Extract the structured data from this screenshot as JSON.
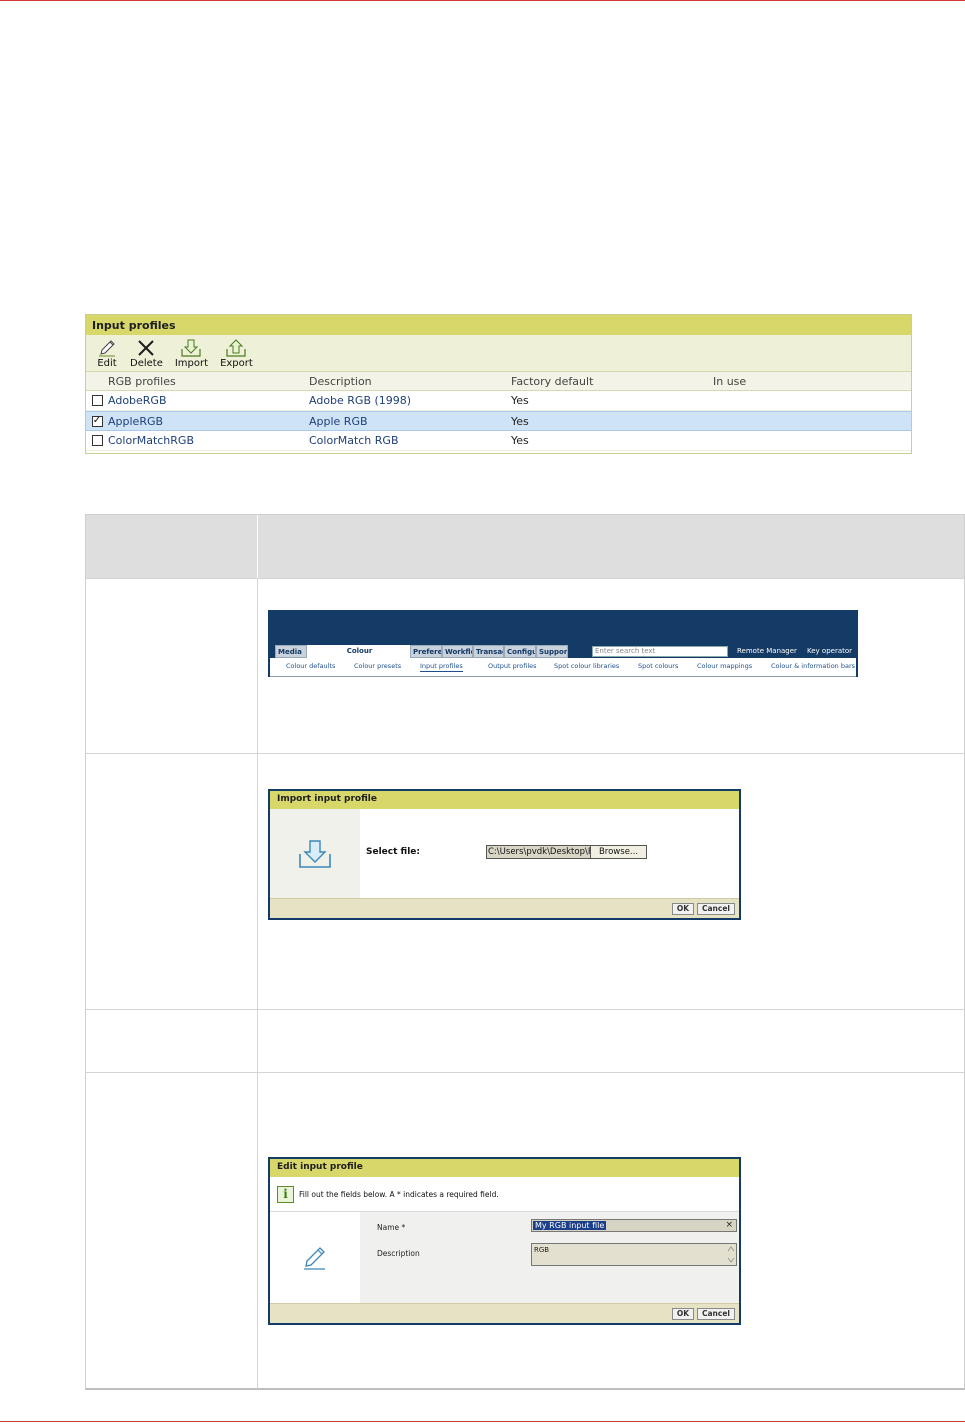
{
  "input_profiles": {
    "title": "Input profiles",
    "toolbar": {
      "edit": "Edit",
      "delete": "Delete",
      "import": "Import",
      "export": "Export"
    },
    "columns": {
      "name": "RGB profiles",
      "description": "Description",
      "factory_default": "Factory default",
      "in_use": "In use"
    },
    "rows": [
      {
        "checked": false,
        "name": "AdobeRGB",
        "description": "Adobe RGB (1998)",
        "factory_default": "Yes",
        "in_use": ""
      },
      {
        "checked": true,
        "name": "AppleRGB",
        "description": "Apple RGB",
        "factory_default": "Yes",
        "in_use": ""
      },
      {
        "checked": false,
        "name": "ColorMatchRGB",
        "description": "ColorMatch RGB",
        "factory_default": "Yes",
        "in_use": ""
      }
    ],
    "check_mark": "✓"
  },
  "navigation": {
    "tabs": {
      "media": "Media",
      "colour": "Colour",
      "preferences": "Preferen",
      "workflow": "Workflo",
      "transactions": "Transac",
      "configuration": "Configu",
      "support": "Support"
    },
    "search_placeholder": "Enter search text",
    "remote_manager": "Remote Manager",
    "key_operator": "Key operator",
    "subtabs": {
      "colour_defaults": "Colour defaults",
      "colour_presets": "Colour presets",
      "input_profiles": "Input profiles",
      "output_profiles": "Output profiles",
      "spot_colour_libraries": "Spot colour libraries",
      "spot_colours": "Spot colours",
      "colour_mappings": "Colour mappings",
      "colour_information_bars": "Colour & information bars"
    }
  },
  "import_dialog": {
    "title": "Import input profile",
    "select_file_label": "Select file:",
    "file_path": "C:\\Users\\pvdk\\Desktop\\R",
    "browse": "Browse...",
    "ok": "OK",
    "cancel": "Cancel"
  },
  "edit_dialog": {
    "title": "Edit input profile",
    "info": "Fill out the fields below. A * indicates a required field.",
    "info_icon": "i",
    "name_label": "Name *",
    "name_value": "My RGB input file",
    "clear": "×",
    "description_label": "Description",
    "description_value": "RGB",
    "ok": "OK",
    "cancel": "Cancel"
  },
  "colors": {
    "title_bar": "#d7d76a",
    "navy": "#143a66",
    "link_blue": "#1f3f7a",
    "selection": "#cfe3f6",
    "rule_red": "#d23a3a"
  }
}
